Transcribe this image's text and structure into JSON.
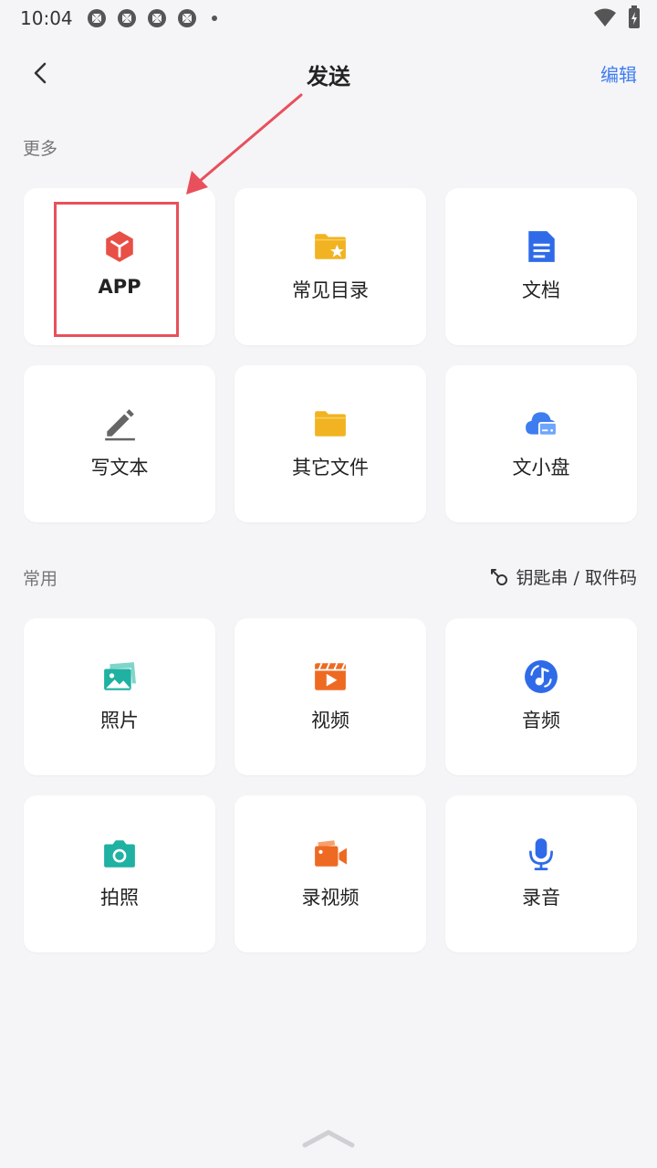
{
  "status_bar": {
    "time": "10:04"
  },
  "header": {
    "title": "发送",
    "edit_label": "编辑"
  },
  "sections": {
    "more": {
      "label": "更多"
    },
    "common": {
      "label": "常用",
      "shortcut_label": "钥匙串 / 取件码"
    }
  },
  "cards": {
    "app": {
      "label": "APP",
      "icon": "cube-icon",
      "color": "#e85047"
    },
    "common_dirs": {
      "label": "常见目录",
      "icon": "folder-star-icon",
      "color": "#f1b322"
    },
    "documents": {
      "label": "文档",
      "icon": "document-icon",
      "color": "#2f6be8"
    },
    "write_text": {
      "label": "写文本",
      "icon": "pencil-icon",
      "color": "#666666"
    },
    "other_files": {
      "label": "其它文件",
      "icon": "folder-icon",
      "color": "#f1b322"
    },
    "cloud_disk": {
      "label": "文小盘",
      "icon": "cloud-drive-icon",
      "color": "#3d7df0"
    },
    "photos": {
      "label": "照片",
      "icon": "photos-icon",
      "color": "#1fb1a2"
    },
    "videos": {
      "label": "视频",
      "icon": "video-clapper-icon",
      "color": "#ee6a22"
    },
    "audio": {
      "label": "音频",
      "icon": "music-disc-icon",
      "color": "#2f6be8"
    },
    "take_photo": {
      "label": "拍照",
      "icon": "camera-icon",
      "color": "#1fb1a2"
    },
    "record_video": {
      "label": "录视频",
      "icon": "video-camera-icon",
      "color": "#ee6a22"
    },
    "record_audio": {
      "label": "录音",
      "icon": "microphone-icon",
      "color": "#2f6be8"
    }
  },
  "colors": {
    "accent": "#3d7df0",
    "highlight": "#e8505b"
  }
}
